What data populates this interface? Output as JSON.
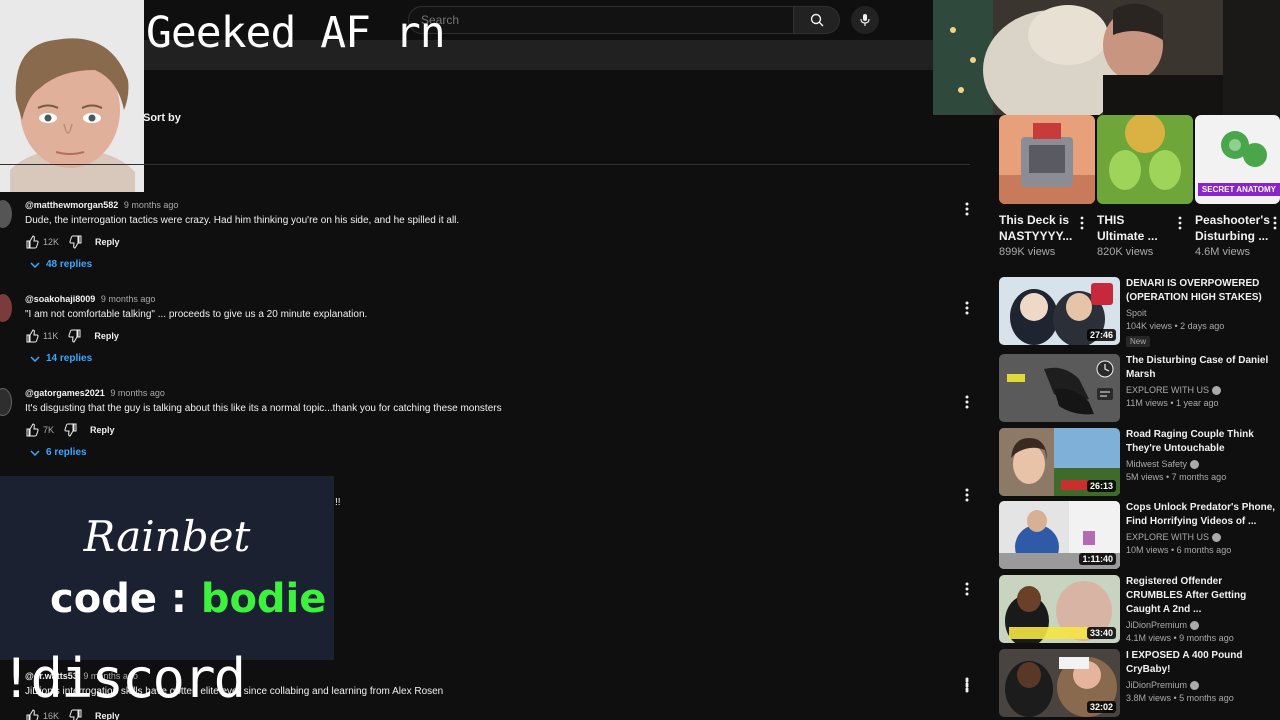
{
  "overlay": {
    "title": "Geeked AF rn",
    "rainbet_logo": "Rainbet",
    "code_prefix": "code : ",
    "code_value": "bodie",
    "discord": "!discord",
    "stray_text": "!!"
  },
  "search": {
    "placeholder": "Search"
  },
  "comments_section": {
    "sort_by": "Sort by"
  },
  "comments": [
    {
      "author": "@matthewmorgan582",
      "time": "9 months ago",
      "text": "Dude, the interrogation tactics were crazy. Had him thinking you're on his side, and he spilled it all.",
      "likes": "12K",
      "reply": "Reply",
      "replies": "48 replies"
    },
    {
      "author": "@soakohaji8009",
      "time": "9 months ago",
      "text": "\"I am not comfortable talking\" ... proceeds to give us a 20 minute explanation.",
      "likes": "11K",
      "reply": "Reply",
      "replies": "14 replies"
    },
    {
      "author": "@gatorgames2021",
      "time": "9 months ago",
      "text": "It's disgusting that the guy is talking about this like its a normal topic...thank you for catching these monsters",
      "likes": "7K",
      "reply": "Reply",
      "replies": "6 replies"
    },
    {
      "author": "@dr.watts53",
      "time": "9 months ago",
      "text": "JiDion's interrogation skills have gotten elite ever since collabing and learning from Alex Rosen",
      "likes": "16K",
      "reply": "Reply"
    }
  ],
  "shorts": [
    {
      "title": "This Deck is NASTYYYY...",
      "views": "899K views"
    },
    {
      "title": "THIS Ultimate ...",
      "views": "820K views"
    },
    {
      "title": "Peashooter's Disturbing ...",
      "views": "4.6M views",
      "badge": "SECRET ANATOMY"
    }
  ],
  "videos": [
    {
      "title": "DENARI IS OVERPOWERED (OPERATION HIGH STAKES)",
      "channel": "Spoit",
      "meta": "104K views • 2 days ago",
      "duration": "27:46",
      "badge": "New",
      "verified": false
    },
    {
      "title": "The Disturbing Case of Daniel Marsh",
      "channel": "EXPLORE WITH US",
      "meta": "11M views • 1 year ago",
      "duration": "",
      "verified": true
    },
    {
      "title": "Road Raging Couple Think They're Untouchable",
      "channel": "Midwest Safety",
      "meta": "5M views • 7 months ago",
      "duration": "26:13",
      "verified": true
    },
    {
      "title": "Cops Unlock Predator's Phone, Find Horrifying Videos of ...",
      "channel": "EXPLORE WITH US",
      "meta": "10M views • 6 months ago",
      "duration": "1:11:40",
      "verified": true
    },
    {
      "title": "Registered Offender CRUMBLES After Getting Caught A 2nd ...",
      "channel": "JiDionPremium",
      "meta": "4.1M views • 9 months ago",
      "duration": "33:40",
      "verified": true
    },
    {
      "title": "I EXPOSED A 400 Pound CryBaby!",
      "channel": "JiDionPremium",
      "meta": "3.8M views • 5 months ago",
      "duration": "32:02",
      "verified": true
    }
  ],
  "colors": {
    "background": "#0f0f0f",
    "link_blue": "#3ea6ff",
    "code_green": "#3cf23c",
    "rainbet_bg": "#1c2132"
  }
}
